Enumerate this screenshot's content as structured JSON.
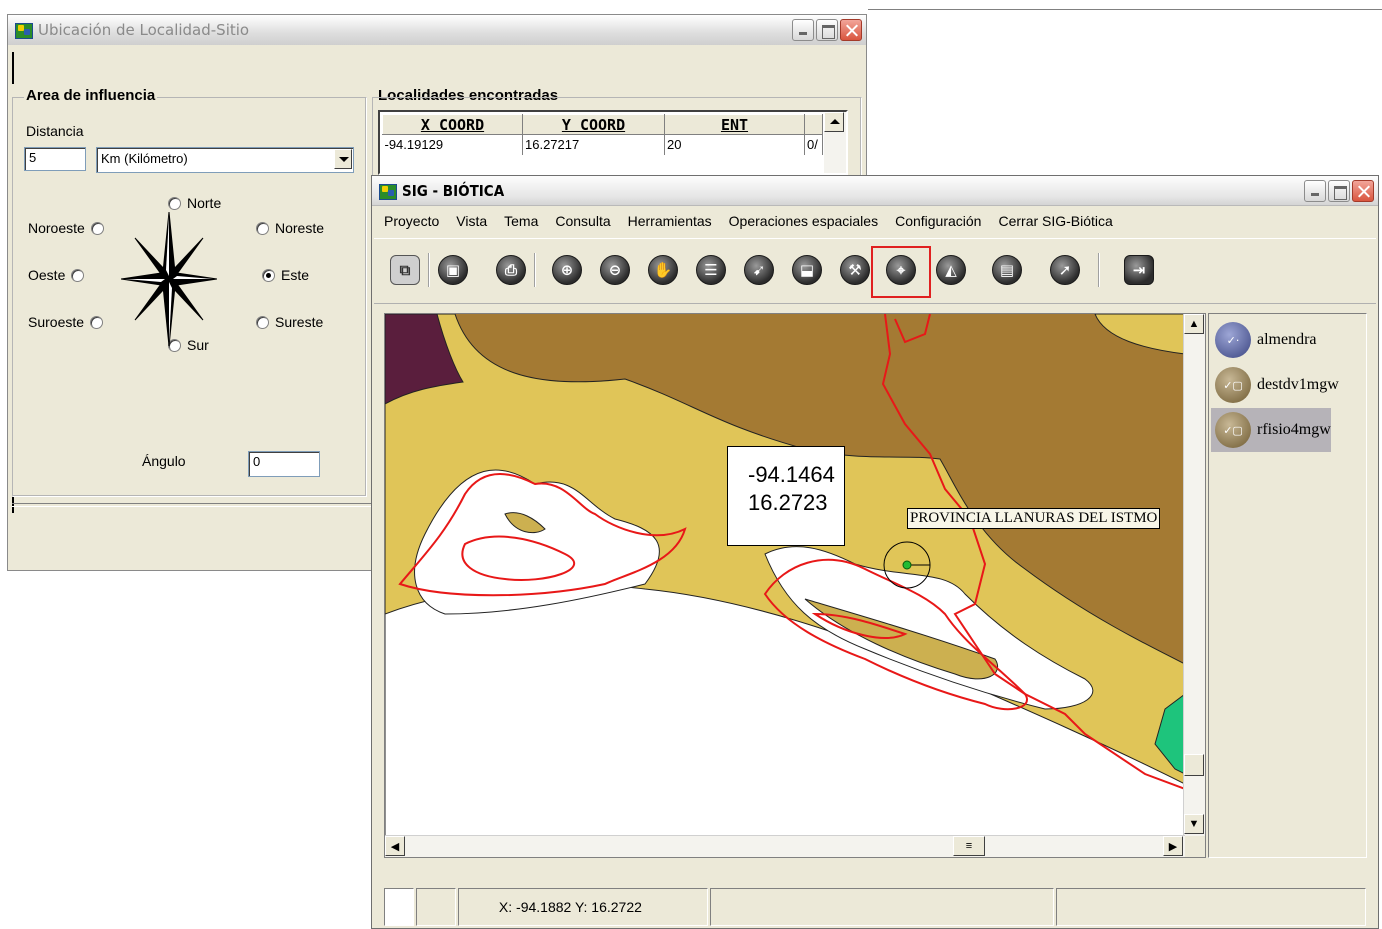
{
  "ubicacion": {
    "title": "Ubicación de Localidad-Sitio",
    "area_group": {
      "legend": "Area de influencia",
      "distance_label": "Distancia",
      "distance_value": "5",
      "unit_selected": "Km (Kilómetro)",
      "directions": {
        "norte": "Norte",
        "noroeste": "Noroeste",
        "noreste": "Noreste",
        "oeste": "Oeste",
        "este": "Este",
        "suroeste": "Suroeste",
        "sureste": "Sureste",
        "sur": "Sur"
      },
      "selected_direction": "Este",
      "angle_label": "Ángulo",
      "angle_value": "0"
    },
    "results": {
      "legend": "Localidades encontradas",
      "columns": [
        "X COORD",
        "Y COORD",
        "ENT"
      ],
      "rows": [
        [
          "-94.19129",
          "16.27217",
          "20",
          "0/"
        ]
      ]
    }
  },
  "sig": {
    "title": "SIG - BIÓTICA",
    "menu": [
      "Proyecto",
      "Vista",
      "Tema",
      "Consulta",
      "Herramientas",
      "Operaciones espaciales",
      "Configuración",
      "Cerrar SIG-Biótica"
    ],
    "tools": [
      "new-project",
      "save",
      "print",
      "zoom-in",
      "zoom-out",
      "pan",
      "layers",
      "identify",
      "select",
      "hammer",
      "locate",
      "polygon",
      "label",
      "arrow",
      "exit"
    ],
    "highlighted_tool": "locate",
    "map": {
      "coord_popup_line1": "-94.1464",
      "coord_popup_line2": "16.2723",
      "feature_label": "PROVINCIA LLANURAS DEL ISTMO",
      "colors": {
        "dark_olive": "#a47a33",
        "light_olive": "#e0c558",
        "mid_olive": "#ccb050",
        "plum": "#5a1e3d",
        "green": "#1ec47c",
        "boundary": "#e81818",
        "point": "#22bb33"
      }
    },
    "layers": [
      {
        "name": "almendra",
        "icon": "point-layer-icon"
      },
      {
        "name": "destdv1mgw",
        "icon": "polygon-layer-icon"
      },
      {
        "name": "rfisio4mgw",
        "icon": "polygon-layer-icon",
        "selected": true
      }
    ],
    "status": {
      "coords": "X: -94.1882  Y: 16.2722"
    }
  }
}
